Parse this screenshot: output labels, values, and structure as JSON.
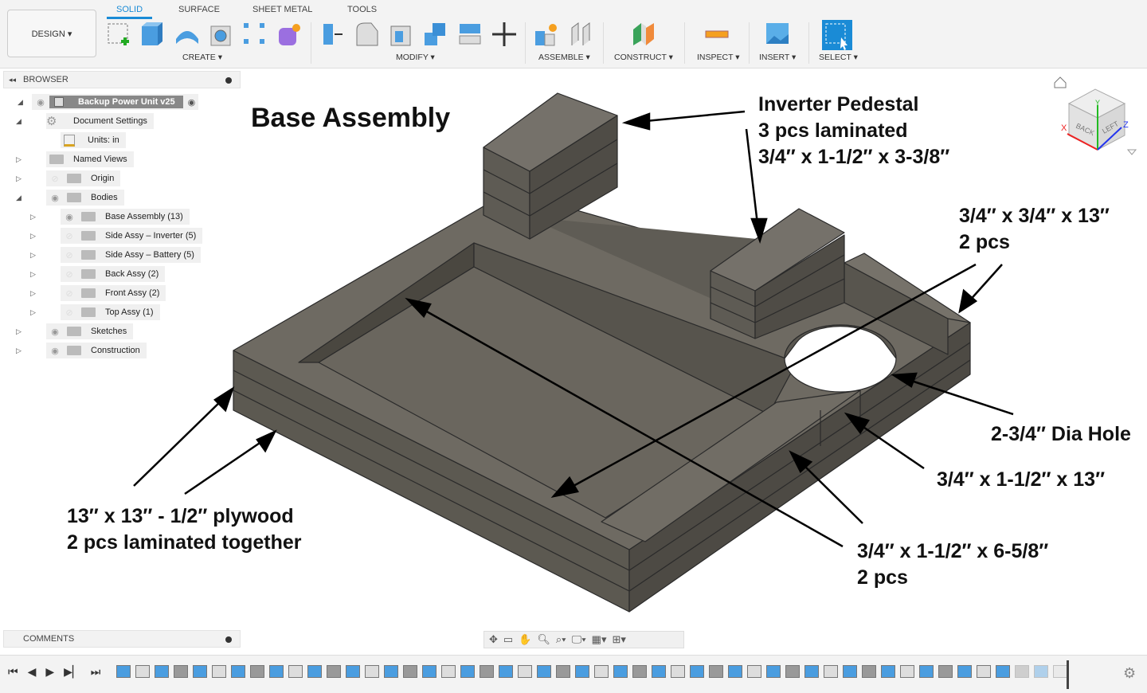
{
  "toolbar": {
    "workspace": "DESIGN ▾",
    "tabs": [
      "SOLID",
      "SURFACE",
      "SHEET METAL",
      "TOOLS"
    ],
    "groups": [
      "CREATE ▾",
      "MODIFY ▾",
      "ASSEMBLE ▾",
      "CONSTRUCT ▾",
      "INSPECT ▾",
      "INSERT ▾",
      "SELECT ▾"
    ]
  },
  "browser": {
    "title": "BROWSER",
    "root": "Backup Power Unit v25",
    "items": [
      {
        "label": "Document Settings",
        "icon": "gear-icon"
      },
      {
        "label": "Units: in",
        "icon": "document-icon"
      },
      {
        "label": "Named Views",
        "icon": "folder-icon"
      },
      {
        "label": "Origin",
        "icon": "folder-icon",
        "visible": false
      },
      {
        "label": "Bodies",
        "icon": "folder-icon",
        "visible": true
      },
      {
        "label": "Base Assembly (13)",
        "visible": true
      },
      {
        "label": "Side Assy – Inverter (5)",
        "visible": false
      },
      {
        "label": "Side Assy – Battery (5)",
        "visible": false
      },
      {
        "label": "Back Assy (2)",
        "visible": false
      },
      {
        "label": "Front Assy (2)",
        "visible": false
      },
      {
        "label": "Top Assy (1)",
        "visible": false
      },
      {
        "label": "Sketches",
        "visible": true
      },
      {
        "label": "Construction",
        "visible": true
      }
    ]
  },
  "comments": {
    "title": "COMMENTS"
  },
  "viewcube": {
    "back": "BACK",
    "left": "LEFT",
    "x": "X",
    "y": "Y",
    "z": "Z"
  },
  "annotations": {
    "title": "Base Assembly",
    "pedestal": [
      "Inverter Pedestal",
      "3 pcs laminated",
      "3/4″ x 1-1/2″ x 3-3/8″"
    ],
    "rail13": [
      "3/4″ x 3/4″ x 13″",
      "2 pcs"
    ],
    "hole": "2-3/4″ Dia Hole",
    "rail15": "3/4″ x 1-1/2″ x 13″",
    "rail658": [
      "3/4″ x 1-1/2″ x 6-5/8″",
      "2 pcs"
    ],
    "plywood": [
      "13″ x 13″ - 1/2″ plywood",
      "2 pcs laminated together"
    ]
  },
  "colors": {
    "accent": "#1a8bd6",
    "model_top": "#6e6a62",
    "model_side": "#5a5750",
    "edge": "#2a2a2a"
  }
}
